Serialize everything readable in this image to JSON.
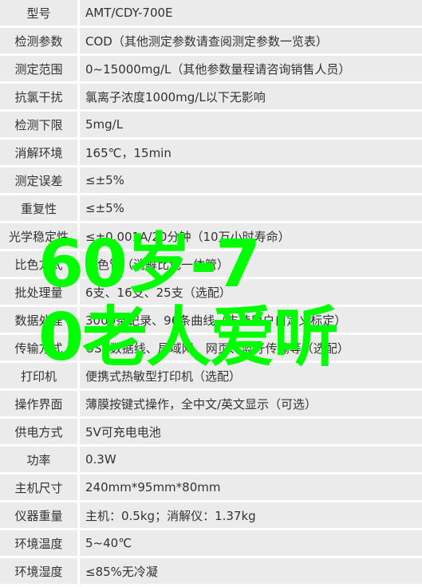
{
  "rows": [
    {
      "k": "型号",
      "v": "AMT/CDY-700E"
    },
    {
      "k": "检测参数",
      "v": "COD（其他测定参数请查阅测定参数一览表）"
    },
    {
      "k": "测定范围",
      "v": "0~15000mg/L（其他参数量程请咨询销售人员）"
    },
    {
      "k": "抗氯干扰",
      "v": "氯离子浓度1000mg/L以下无影响"
    },
    {
      "k": "检测下限",
      "v": "5mg/L"
    },
    {
      "k": "消解环境",
      "v": "165℃，15min"
    },
    {
      "k": "测定误差",
      "v": "≤±5%"
    },
    {
      "k": "重复性",
      "v": "≤±5%"
    },
    {
      "k": "光学稳定性",
      "v": "≤±0.001A/20分钟（10万小时寿命）"
    },
    {
      "k": "比色方式",
      "v": "比色管（消解比色一体管）"
    },
    {
      "k": "批处理量",
      "v": "6支、16支、25支（选配）"
    },
    {
      "k": "数据处理",
      "v": "3000条记录、96条曲线（支持用户自定义标定）"
    },
    {
      "k": "传输方式",
      "v": "USB数据线、局域网、网页、蓝牙传输等（选配）"
    },
    {
      "k": "打印机",
      "v": "便携式热敏型打印机（选配）"
    },
    {
      "k": "操作界面",
      "v": "薄膜按键式操作，全中文/英文显示（可选）"
    },
    {
      "k": "供电方式",
      "v": "5V可充电电池"
    },
    {
      "k": "功率",
      "v": "0.3W"
    },
    {
      "k": "主机尺寸",
      "v": "240mm*95mm*80mm"
    },
    {
      "k": "仪器重量",
      "v": "主机：0.5kg；消解仪：1.37kg"
    },
    {
      "k": "环境温度",
      "v": "5~40℃"
    },
    {
      "k": "环境湿度",
      "v": "≤85%无冷凝"
    }
  ],
  "overlay": {
    "line1": "60岁-7",
    "line2": "0老人爱听",
    "color": "#00ff00"
  }
}
